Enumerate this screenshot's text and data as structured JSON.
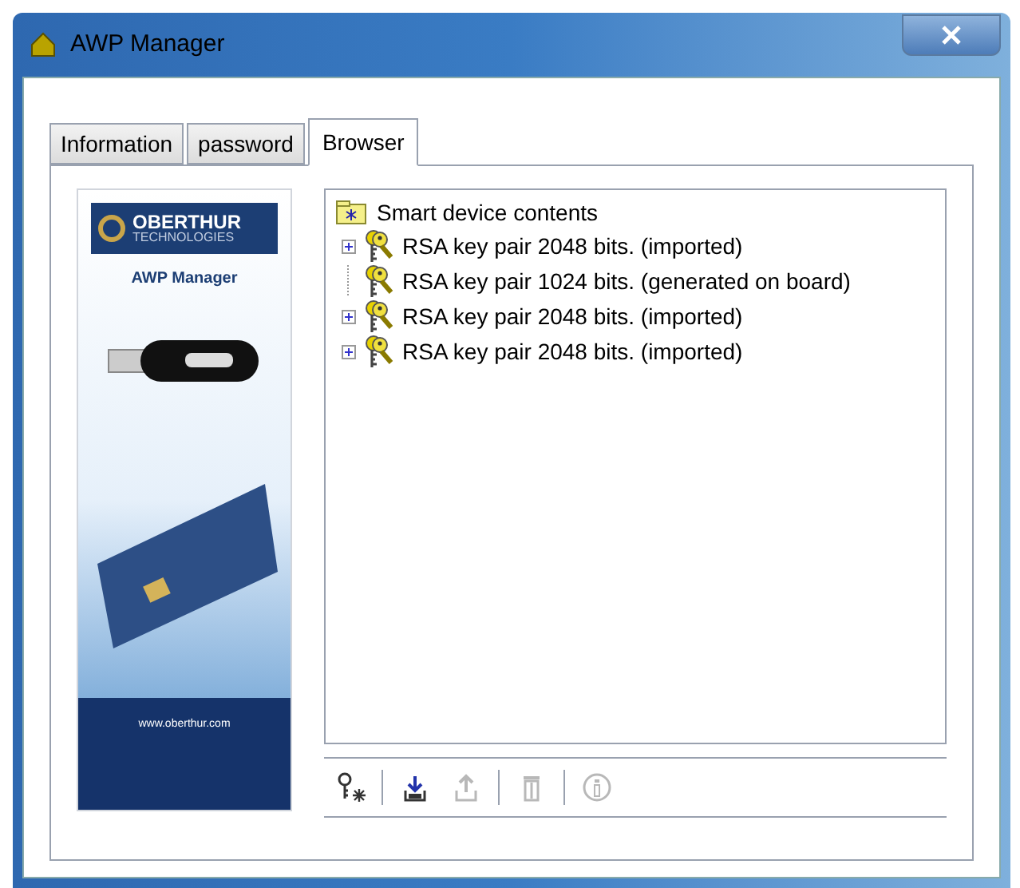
{
  "window": {
    "title": "AWP Manager"
  },
  "tabs": [
    {
      "label": "Information",
      "selected": false
    },
    {
      "label": "password",
      "selected": false
    },
    {
      "label": "Browser",
      "selected": true
    }
  ],
  "banner": {
    "brand": "OBERTHUR",
    "brand_sub": "TECHNOLOGIES",
    "product": "AWP Manager",
    "website": "www.oberthur.com"
  },
  "tree": {
    "label": "Smart device contents",
    "children": [
      {
        "label": "RSA key pair 2048 bits. (imported)",
        "expandable": true
      },
      {
        "label": "RSA key pair 1024 bits. (generated on board)",
        "expandable": false
      },
      {
        "label": "RSA key pair 2048 bits. (imported)",
        "expandable": true
      },
      {
        "label": "RSA key pair 2048 bits. (imported)",
        "expandable": true
      }
    ]
  },
  "toolbar": [
    {
      "kind": "new-key",
      "disabled": false
    },
    {
      "kind": "import",
      "disabled": false
    },
    {
      "kind": "export",
      "disabled": true
    },
    {
      "kind": "delete",
      "disabled": true
    },
    {
      "kind": "info",
      "disabled": true
    }
  ]
}
